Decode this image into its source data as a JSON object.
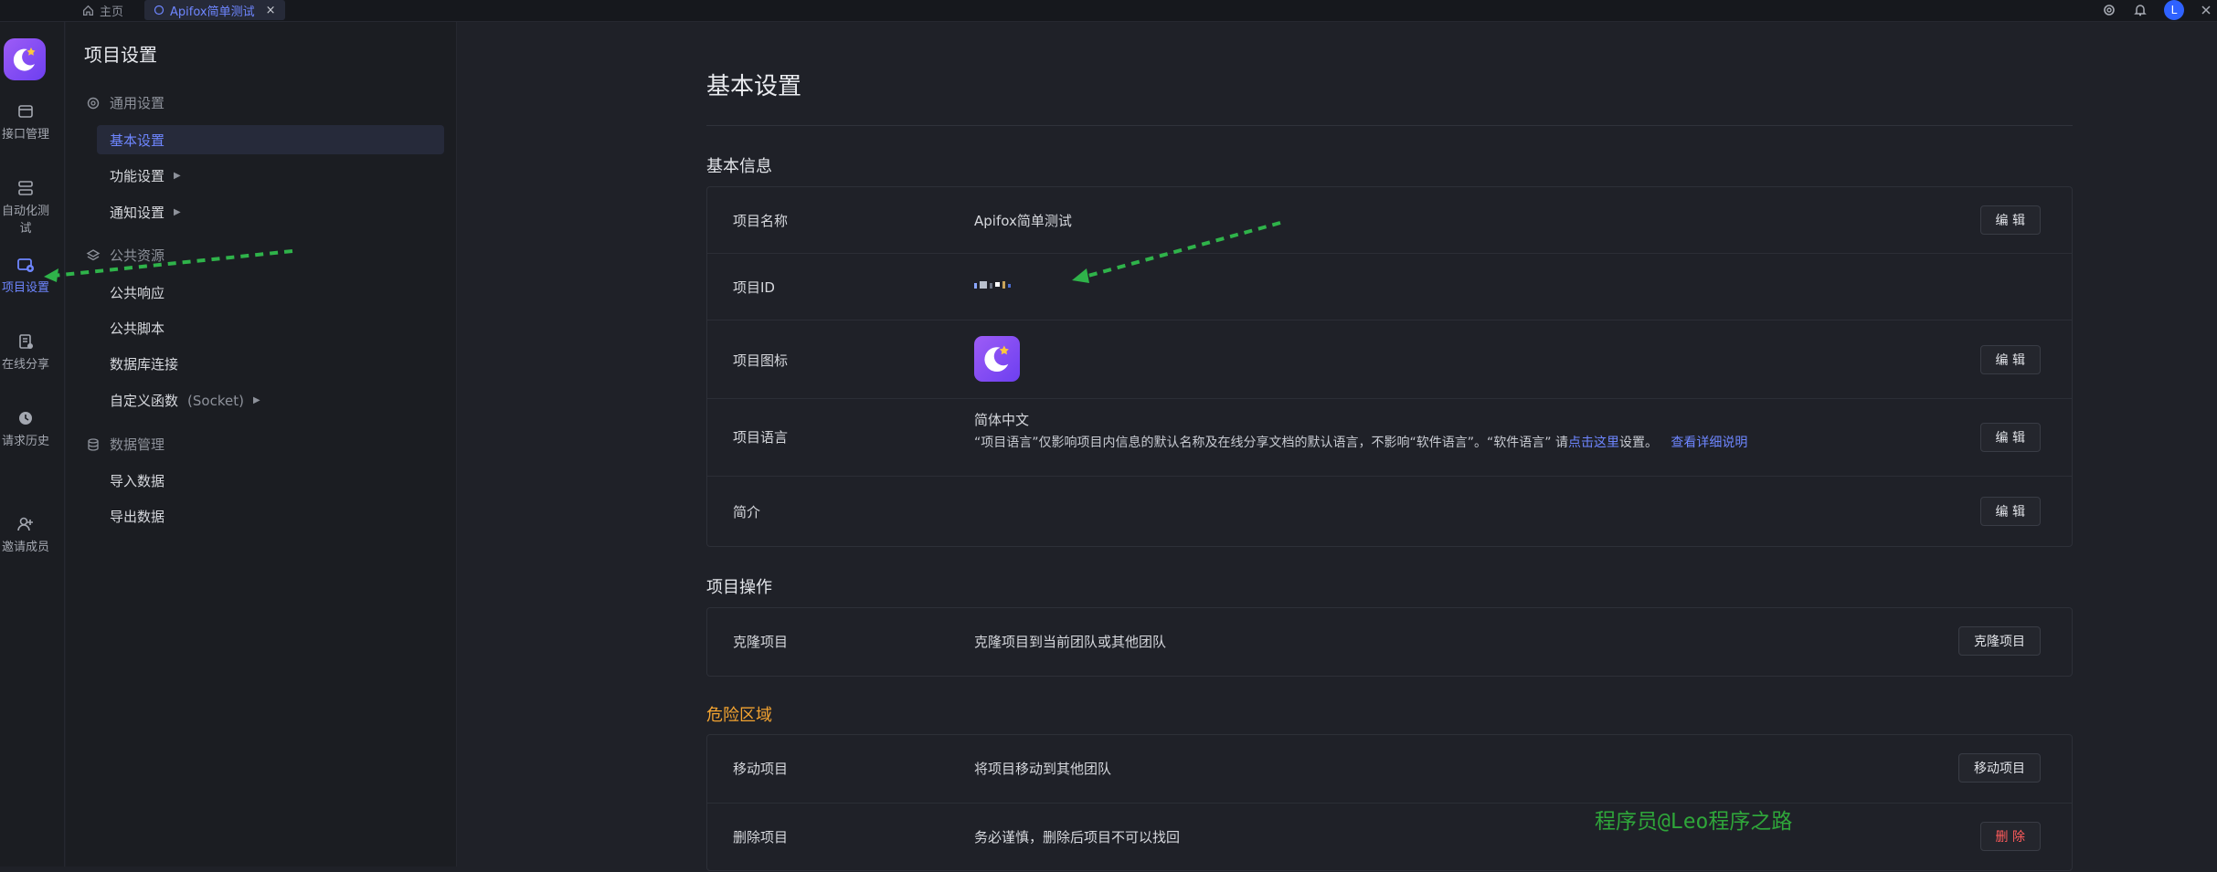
{
  "tabs": {
    "home_label": "主页",
    "active_label": "Apifox简单测试",
    "close_glyph": "×"
  },
  "top_icons": [
    "gear-icon",
    "bell-icon",
    "user-avatar",
    "close-icon"
  ],
  "avatar_initial": "L",
  "rail": {
    "items": [
      {
        "label": "接口管理",
        "icon": "api-icon"
      },
      {
        "label": "自动化测试",
        "icon": "automation-icon"
      },
      {
        "label": "项目设置",
        "icon": "project-settings-icon",
        "active": true
      },
      {
        "label": "在线分享",
        "icon": "share-icon"
      },
      {
        "label": "请求历史",
        "icon": "history-icon"
      },
      {
        "label": "邀请成员",
        "icon": "invite-icon"
      }
    ]
  },
  "nav": {
    "title": "项目设置",
    "groups": {
      "general": "通用设置",
      "public": "公共资源",
      "data": "数据管理"
    },
    "items": {
      "basic": "基本设置",
      "feature": "功能设置",
      "notify": "通知设置",
      "public_response": "公共响应",
      "public_script": "公共脚本",
      "db_connect": "数据库连接",
      "custom_func": "自定义函数",
      "custom_func_suffix": "(Socket)",
      "import": "导入数据",
      "export": "导出数据"
    }
  },
  "main": {
    "title": "基本设置",
    "basic_info": {
      "section": "基本信息",
      "name_label": "项目名称",
      "name_value": "Apifox简单测试",
      "id_label": "项目ID",
      "icon_label": "项目图标",
      "lang_label": "项目语言",
      "lang_value": "简体中文",
      "lang_hint_pre": "“项目语言”仅影响项目内信息的默认名称及在线分享文档的默认语言，不影响“软件语言”。“软件语言” 请",
      "lang_hint_link": "点击这里",
      "lang_hint_post": "设置。",
      "lang_detail_link": "查看详细说明",
      "intro_label": "简介",
      "edit_label": "编 辑"
    },
    "ops": {
      "section": "项目操作",
      "clone_label": "克隆项目",
      "clone_value": "克隆项目到当前团队或其他团队",
      "clone_button": "克隆项目"
    },
    "danger": {
      "section": "危险区域",
      "move_label": "移动项目",
      "move_value": "将项目移动到其他团队",
      "move_button": "移动项目",
      "delete_label": "删除项目",
      "delete_value": "务必谨慎，删除后项目不可以找回",
      "delete_button": "删 除"
    }
  },
  "watermark": "程序员@Leo程序之路",
  "colors": {
    "accent": "#6e86ff",
    "danger_title": "#f3a431",
    "danger_button": "#ff5b5b",
    "arrow": "#2fb34a"
  }
}
